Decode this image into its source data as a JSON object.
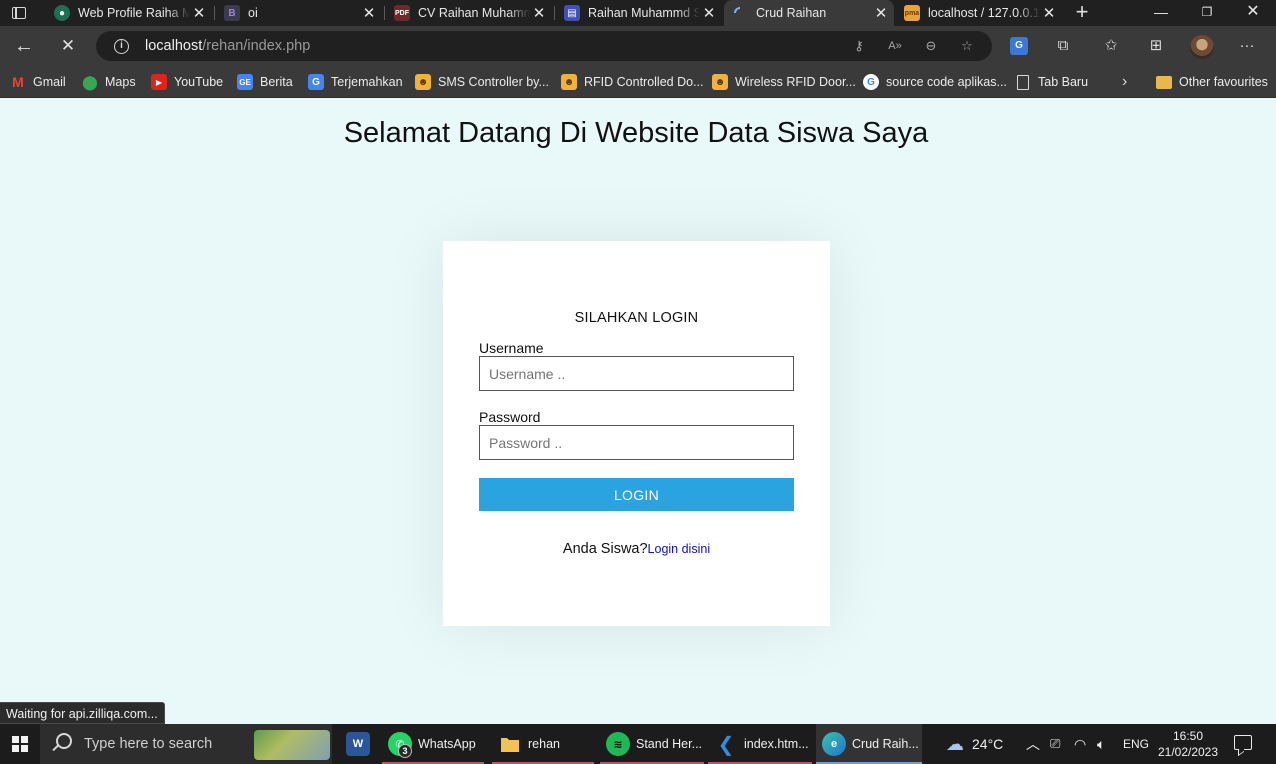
{
  "browser": {
    "tabs": [
      {
        "title": "Web Profile Raiha M",
        "favicon": "globe-green-icon",
        "active": false
      },
      {
        "title": "oi",
        "favicon": "bootstrap-icon",
        "active": false
      },
      {
        "title": "CV Raihan Muhamm",
        "favicon": "pdf-icon",
        "active": false
      },
      {
        "title": "Raihan Muhammd S",
        "favicon": "site-blue-icon",
        "active": false
      },
      {
        "title": "Crud Raihan",
        "favicon": "loading-spinner-icon",
        "active": true
      },
      {
        "title": "localhost / 127.0.0.1",
        "favicon": "phpmyadmin-icon",
        "active": false
      }
    ],
    "address": {
      "info_icon": "i",
      "host": "localhost",
      "path": "/rehan/index.php"
    },
    "bookmarks": [
      {
        "label": "Gmail",
        "icon": "gmail-icon"
      },
      {
        "label": "Maps",
        "icon": "maps-icon"
      },
      {
        "label": "YouTube",
        "icon": "youtube-icon"
      },
      {
        "label": "Berita",
        "icon": "news-icon"
      },
      {
        "label": "Terjemahkan",
        "icon": "translate-icon"
      },
      {
        "label": "SMS Controller by...",
        "icon": "site-icon"
      },
      {
        "label": "RFID Controlled Do...",
        "icon": "site-icon"
      },
      {
        "label": "Wireless RFID Door...",
        "icon": "site-icon"
      },
      {
        "label": "source code aplikas...",
        "icon": "google-icon"
      },
      {
        "label": "Tab Baru",
        "icon": "page-icon"
      }
    ],
    "other_favourites": "Other favourites",
    "status_text": "Waiting for api.zilliqa.com..."
  },
  "page": {
    "title": "Selamat Datang Di Website Data Siswa Saya",
    "login": {
      "heading": "SILAHKAN LOGIN",
      "username_label": "Username",
      "username_placeholder": "Username ..",
      "username_value": "",
      "password_label": "Password",
      "password_placeholder": "Password ..",
      "password_value": "",
      "button_label": "LOGIN",
      "footer_text": "Anda Siswa?",
      "footer_link": "Login disini"
    }
  },
  "taskbar": {
    "search_placeholder": "Type here to search",
    "apps": [
      {
        "label": "",
        "icon": "word-icon"
      },
      {
        "label": "WhatsApp",
        "icon": "whatsapp-icon",
        "badge": "3"
      },
      {
        "label": "rehan",
        "icon": "folder-icon"
      },
      {
        "label": "Stand Her...",
        "icon": "spotify-icon"
      },
      {
        "label": "index.htm...",
        "icon": "vscode-icon"
      },
      {
        "label": "Crud Raih...",
        "icon": "edge-icon"
      }
    ],
    "weather": "24°C",
    "language": "ENG",
    "time": "16:50",
    "date": "21/02/2023"
  },
  "colors": {
    "page_bg": "#e9f8f8",
    "login_button": "#29a4e1",
    "link": "#1010c8"
  }
}
